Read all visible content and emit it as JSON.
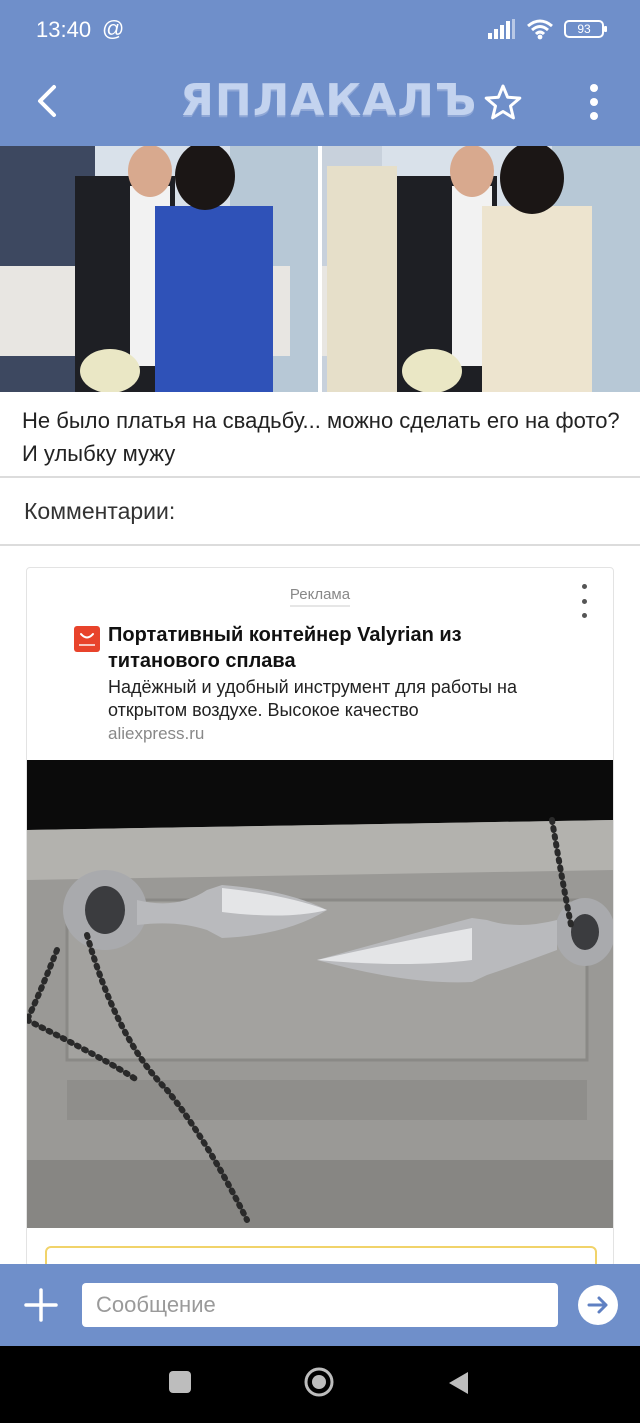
{
  "status_bar": {
    "time": "13:40",
    "at_symbol": "@",
    "battery": "93"
  },
  "app_bar": {
    "logo": "ЯПЛАКАЛЪ"
  },
  "post": {
    "caption": "Не было платья на свадьбу... можно сделать его на фото? И улыбку мужу"
  },
  "comments": {
    "header": "Комментарии:"
  },
  "ad": {
    "label": "Реклама",
    "title": "Портативный контейнер Valyrian из титанового сплава",
    "description": "Надёжный и удобный инструмент для работы на открытом воздухе. Высокое качество",
    "domain": "aliexpress.ru"
  },
  "composer": {
    "placeholder": "Сообщение"
  },
  "colors": {
    "accent": "#6f8fca",
    "ad_favicon": "#e8432b",
    "cta_border": "#f1d36a"
  }
}
